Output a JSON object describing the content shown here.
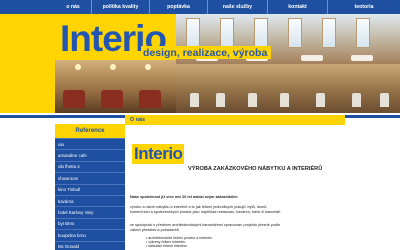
{
  "nav": {
    "items": [
      {
        "label": "o nás"
      },
      {
        "label": "politika kvality"
      },
      {
        "label": "poptávka"
      },
      {
        "label": "naše služby"
      },
      {
        "label": "kontakt"
      },
      {
        "label": "teotoria"
      }
    ]
  },
  "header": {
    "logo": "Interio",
    "slogan_parts": [
      "design, realizace, výroba"
    ]
  },
  "sidebar": {
    "heading": "Reference",
    "items": [
      {
        "label": "oia"
      },
      {
        "label": "amandine cafe"
      },
      {
        "label": "ola fhetta 4"
      },
      {
        "label": "showroom"
      },
      {
        "label": "kino Tinbull"
      },
      {
        "label": "kavárna"
      },
      {
        "label": "hotel Karlovy Vary"
      },
      {
        "label": "byt Brno"
      },
      {
        "label": "koupelna brno"
      },
      {
        "label": "Mc Donald"
      }
    ]
  },
  "content": {
    "title": "O nás",
    "logo": "Interio",
    "heading": "VÝROBA ZAKÁZKOVÉHO NÁBYTKU A INTERIÉRŮ",
    "para1": "Naše společnost již více než 20 let nabízí svým zákazníkům:",
    "para2a": "výrobu a návrh nábytku a interiérů a to jak řešení jednotlivých pokojů, bytů, domů,",
    "para2b": "komerčních a společenských prostor jako například restaurací, kaváren, bank či kanceláří",
    "para3a": "ve spolupráci s předními architektonickými kancelářemi zpracování projektu přesně podle",
    "para3b": "vašich představ a požadavků",
    "bullets": [
      "architektonické řešení prostor a interiéru",
      "výkresy řešení interiéru",
      "kalkulaci řešení interiéru"
    ]
  }
}
